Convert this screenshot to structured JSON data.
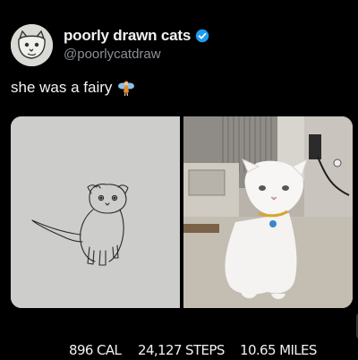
{
  "tweet": {
    "author_name": "poorly drawn cats",
    "author_handle": "@poorlycatdraw",
    "text": "she was a fairy",
    "emoji_icon": "fairy-icon",
    "verified_color": "#1d9bf0"
  },
  "media": {
    "left_image": "cat-drawing-image",
    "right_image": "white-cat-photo-image"
  },
  "stats": {
    "calories": "896 CAL",
    "steps": "24,127 STEPS",
    "miles": "10.65 MILES"
  }
}
